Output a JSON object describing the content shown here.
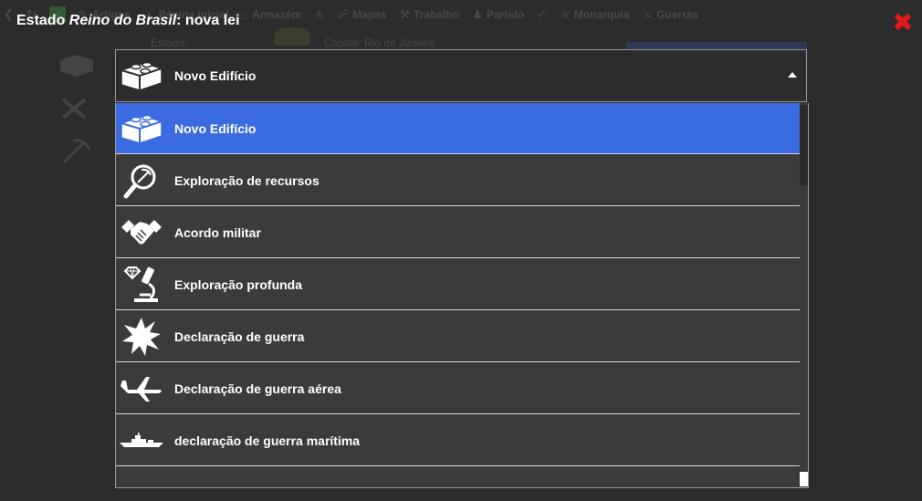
{
  "background_nav": {
    "items": [
      {
        "icon": "back-arrow-icon",
        "label": ""
      },
      {
        "icon": "refresh-icon",
        "label": ""
      },
      {
        "icon": "checkbox-icon",
        "label": ""
      },
      {
        "icon": "article-icon",
        "label": "Artigos"
      },
      {
        "icon": "home-icon",
        "label": "Página inicial"
      },
      {
        "icon": "warehouse-icon",
        "label": "Armazém"
      },
      {
        "icon": "factory-icon",
        "label": ""
      },
      {
        "icon": "map-icon",
        "label": "Mapas"
      },
      {
        "icon": "pickaxe-icon",
        "label": "Trabalho"
      },
      {
        "icon": "party-icon",
        "label": "Partido"
      },
      {
        "icon": "check-icon",
        "label": ""
      },
      {
        "icon": "crown-icon",
        "label": "Monarquia"
      },
      {
        "icon": "war-icon",
        "label": "Guerras"
      }
    ],
    "state_label": "Estado:",
    "capital_label": "Capital: Rio de Janeiro"
  },
  "modal": {
    "title_prefix": "Estado ",
    "state_name": "Reino do Brasil",
    "title_suffix": ": nova lei",
    "close_icon": "close-icon",
    "close_color": "#e01818"
  },
  "select": {
    "selected_label": "Novo Edifício",
    "selected_icon": "brick-icon",
    "options": [
      {
        "label": "Novo Edifício",
        "icon": "brick-icon",
        "selected": true
      },
      {
        "label": "Exploração de recursos",
        "icon": "magnifier-pickaxe-icon",
        "selected": false
      },
      {
        "label": "Acordo militar",
        "icon": "handshake-icon",
        "selected": false
      },
      {
        "label": "Exploração profunda",
        "icon": "microscope-diamond-icon",
        "selected": false
      },
      {
        "label": "Declaração de guerra",
        "icon": "explosion-icon",
        "selected": false
      },
      {
        "label": "Declaração de guerra aérea",
        "icon": "airplane-icon",
        "selected": false
      },
      {
        "label": "declaração de guerra marítima",
        "icon": "warship-icon",
        "selected": false
      },
      {
        "label": "",
        "icon": "",
        "selected": false
      }
    ]
  },
  "colors": {
    "selected_bg": "#3a6be0",
    "option_bg": "#3b3b3b",
    "page_bg": "#2c2c2c"
  }
}
